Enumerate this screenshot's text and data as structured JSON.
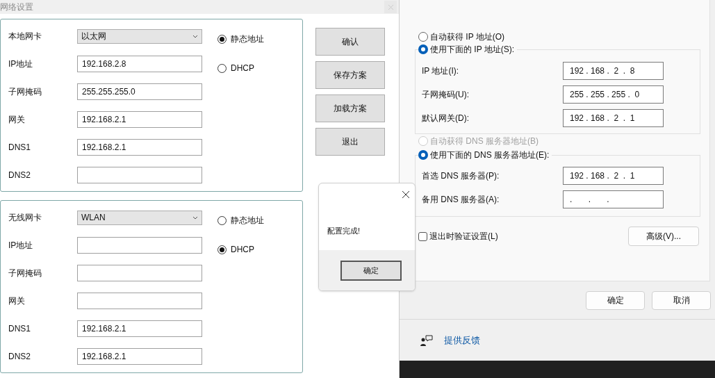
{
  "app": {
    "title": "网络设置",
    "groups": [
      {
        "adapter_label": "本地网卡",
        "adapter": "以太网",
        "fields": [
          {
            "label": "IP地址",
            "value": "192.168.2.8"
          },
          {
            "label": "子网掩码",
            "value": "255.255.255.0"
          },
          {
            "label": "网关",
            "value": "192.168.2.1"
          },
          {
            "label": "DNS1",
            "value": "192.168.2.1"
          },
          {
            "label": "DNS2"
          }
        ],
        "modes": [
          {
            "label": "静态地址",
            "selected": true
          },
          {
            "label": "DHCP",
            "selected": false
          }
        ]
      },
      {
        "adapter_label": "无线网卡",
        "adapter": "WLAN",
        "fields": [
          {
            "label": "IP地址"
          },
          {
            "label": "子网掩码"
          },
          {
            "label": "网关"
          },
          {
            "label": "DNS1",
            "value": "192.168.2.1"
          },
          {
            "label": "DNS2",
            "value": "192.168.2.1"
          }
        ],
        "modes": [
          {
            "label": "静态地址",
            "selected": false
          },
          {
            "label": "DHCP",
            "selected": true
          }
        ]
      }
    ],
    "buttons": [
      "确认",
      "保存方案",
      "加载方案",
      "退出"
    ]
  },
  "message_box": {
    "text": "配置完成!",
    "button": "确定"
  },
  "ipv4": {
    "ip_options": [
      {
        "label": "自动获得 IP 地址(O)",
        "selected": false,
        "disabled": false
      },
      {
        "label": "使用下面的 IP 地址(S):",
        "selected": true,
        "disabled": false
      }
    ],
    "ip_fields": [
      {
        "label": "IP 地址(I):",
        "value": "192 . 168 .  2  .  8"
      },
      {
        "label": "子网掩码(U):",
        "value": "255 . 255 . 255 .  0"
      },
      {
        "label": "默认网关(D):",
        "value": "192 . 168 .  2  .  1"
      }
    ],
    "dns_options": [
      {
        "label": "自动获得 DNS 服务器地址(B)",
        "selected": false,
        "disabled": true
      },
      {
        "label": "使用下面的 DNS 服务器地址(E):",
        "selected": true,
        "disabled": false
      }
    ],
    "dns_fields": [
      {
        "label": "首选 DNS 服务器(P):",
        "value": "192 . 168 .  2  .  1"
      },
      {
        "label": "备用 DNS 服务器(A):",
        "value": ".       .       ."
      }
    ],
    "validate": {
      "label": "退出时验证设置(L)",
      "checked": false
    },
    "advanced": "高级(V)...",
    "buttons": [
      "确定",
      "取消"
    ],
    "feedback": "提供反馈"
  }
}
